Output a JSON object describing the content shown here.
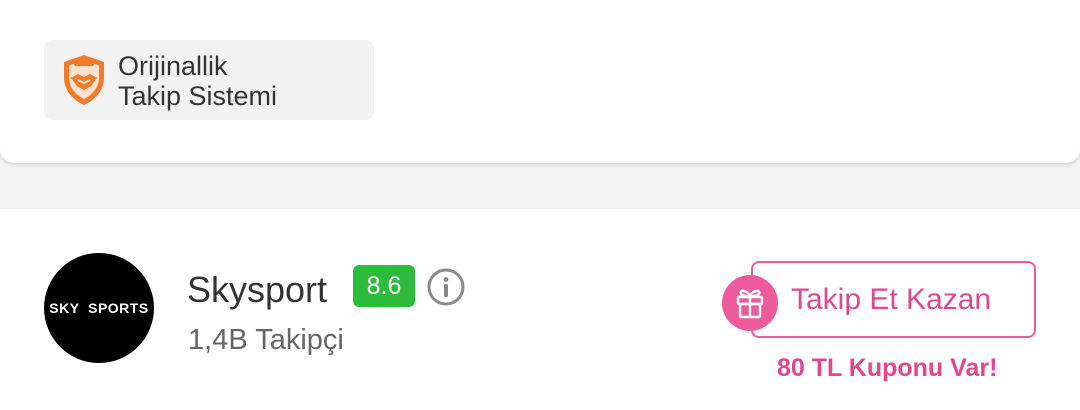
{
  "badge": {
    "line1": "Orijinallik",
    "line2": "Takip Sistemi",
    "icon": "shield-handshake-icon",
    "icon_color": "#f07b2b"
  },
  "seller": {
    "logo_text": "SKY  SPORTS",
    "name": "Skysport",
    "rating": "8.6",
    "rating_color": "#2dbb3c",
    "followers": "1,4B Takipçi",
    "follow_button": "Takip Et Kazan",
    "coupon": "80 TL Kuponu Var!",
    "accent_color": "#e0478e"
  }
}
